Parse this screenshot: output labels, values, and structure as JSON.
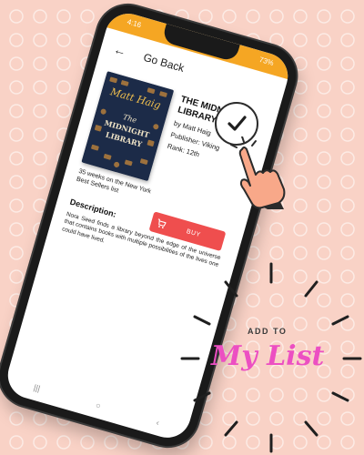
{
  "status_bar": {
    "time": "4:16",
    "battery": "73%"
  },
  "header": {
    "back_icon": "arrow-left-icon",
    "title": "Go Back"
  },
  "book": {
    "cover_author": "Matt Haig",
    "cover_title_line1": "The",
    "cover_title_line2": "MIDNIGHT",
    "cover_title_line3": "LIBRARY",
    "title": "THE MIDNIGHT LIBRARY",
    "author": "by Matt Haig",
    "publisher": "Publisher: Viking",
    "rank": "Rank: 12th",
    "bestseller_note": "35 weeks on the New York Best Sellers list"
  },
  "buy_button": {
    "label": "BUY",
    "icon": "cart-icon"
  },
  "description": {
    "label": "Description:",
    "text": "Nora Seed finds a library beyond the edge of the universe that contains books with multiple possibilities of the lives one could have lived."
  },
  "nav_bar": {
    "icons": [
      "recent-apps-icon",
      "home-icon",
      "back-icon"
    ],
    "glyphs": [
      "|||",
      "○",
      "‹"
    ]
  },
  "promo": {
    "line1": "ADD TO",
    "line2": "My List"
  },
  "colors": {
    "background": "#f9d2c6",
    "status_bar": "#f5a623",
    "buy_button": "#ef4e4e",
    "promo_text": "#ec4fc2"
  }
}
